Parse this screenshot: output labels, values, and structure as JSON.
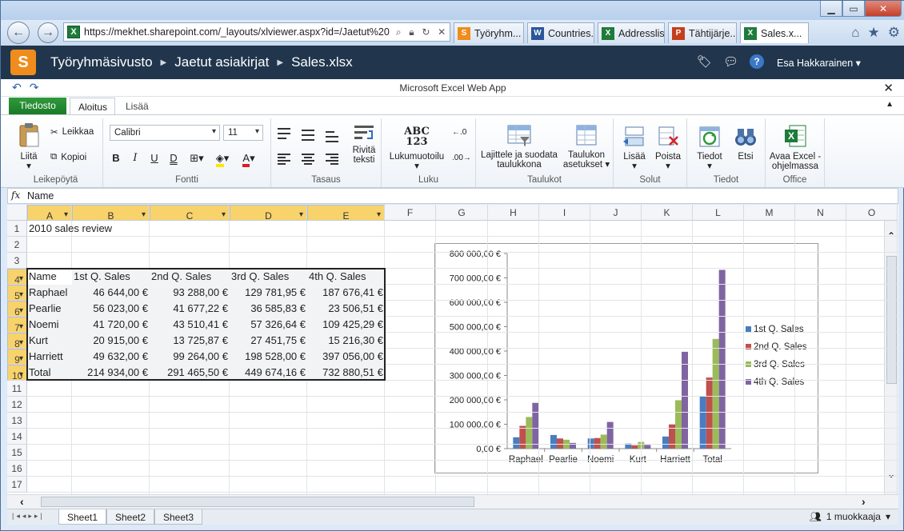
{
  "browser": {
    "url": "https://mekhet.sharepoint.com/_layouts/xlviewer.aspx?id=/Jaetut%20",
    "tabs": [
      {
        "label": "Työryhm...",
        "icon": "sharepoint",
        "color": "#f08c1c"
      },
      {
        "label": "Countries...",
        "icon": "word",
        "color": "#2b579a"
      },
      {
        "label": "Addresslis...",
        "icon": "excel",
        "color": "#1e7b3b"
      },
      {
        "label": "Tähtijärje...",
        "icon": "powerpoint",
        "color": "#c43e1c"
      },
      {
        "label": "Sales.x...",
        "icon": "excel",
        "color": "#1e7b3b"
      }
    ]
  },
  "sharepoint": {
    "breadcrumb": [
      "Työryhmäsivusto",
      "Jaetut asiakirjat",
      "Sales.xlsx"
    ],
    "user": "Esa Hakkarainen",
    "help": "?"
  },
  "app": {
    "title": "Microsoft Excel Web App",
    "tabs": {
      "file": "Tiedosto",
      "home": "Aloitus",
      "more": "Lisää"
    }
  },
  "ribbon": {
    "paste": "Liitä",
    "cut": "Leikkaa",
    "copy": "Kopioi",
    "clipboard_group": "Leikepöytä",
    "font_name": "Calibri",
    "font_size": "11",
    "font_group": "Fontti",
    "bold": "B",
    "italic": "I",
    "underline": "U",
    "double_underline": "D",
    "wrap": "Rivitä teksti",
    "align_group": "Tasaus",
    "number_format": "Lukumuotoilu",
    "number_icon": "ABC 123",
    "number_group": "Luku",
    "sort_filter": "Lajittele ja suodata taulukkona",
    "table_options": "Taulukon asetukset",
    "tables_group": "Taulukot",
    "insert": "Lisää",
    "delete": "Poista",
    "cells_group": "Solut",
    "data": "Tiedot",
    "find": "Etsi",
    "data_group": "Tiedot",
    "open_excel": "Avaa Excel -ohjelmassa",
    "office_group": "Office"
  },
  "formula_bar": {
    "fx": "fx",
    "value": "Name"
  },
  "columns": [
    "A",
    "B",
    "C",
    "D",
    "E",
    "F",
    "G",
    "H",
    "I",
    "J",
    "K",
    "L",
    "M",
    "N",
    "O"
  ],
  "rows": [
    "1",
    "2",
    "3",
    "4",
    "5",
    "6",
    "7",
    "8",
    "9",
    "10",
    "11",
    "12",
    "13",
    "14",
    "15",
    "16",
    "17"
  ],
  "sheet": {
    "a1": "2010 sales review",
    "header": [
      "Name",
      "1st Q. Sales",
      "2nd Q. Sales",
      "3rd Q. Sales",
      "4th Q. Sales"
    ],
    "data": [
      [
        "Raphael",
        "46 644,00 €",
        "93 288,00 €",
        "129 781,95 €",
        "187 676,41 €"
      ],
      [
        "Pearlie",
        "56 023,00 €",
        "41 677,22 €",
        "36 585,83 €",
        "23 506,51 €"
      ],
      [
        "Noemi",
        "41 720,00 €",
        "43 510,41 €",
        "57 326,64 €",
        "109 425,29 €"
      ],
      [
        "Kurt",
        "20 915,00 €",
        "13 725,87 €",
        "27 451,75 €",
        "15 216,30 €"
      ],
      [
        "Harriett",
        "49 632,00 €",
        "99 264,00 €",
        "198 528,00 €",
        "397 056,00 €"
      ],
      [
        "Total",
        "214 934,00 €",
        "291 465,50 €",
        "449 674,16 €",
        "732 880,51 €"
      ]
    ]
  },
  "chart_data": {
    "type": "bar",
    "categories": [
      "Raphael",
      "Pearlie",
      "Noemi",
      "Kurt",
      "Harriett",
      "Total"
    ],
    "series": [
      {
        "name": "1st Q. Sales",
        "color": "#4a7dbf",
        "values": [
          46644,
          56023,
          41720,
          20915,
          49632,
          214934
        ]
      },
      {
        "name": "2nd Q. Sales",
        "color": "#c0504d",
        "values": [
          93288,
          41677.22,
          43510.41,
          13725.87,
          99264,
          291465.5
        ]
      },
      {
        "name": "3rd Q. Sales",
        "color": "#9bbb59",
        "values": [
          129781.95,
          36585.83,
          57326.64,
          27451.75,
          198528,
          449674.16
        ]
      },
      {
        "name": "4th Q. Sales",
        "color": "#8064a2",
        "values": [
          187676.41,
          23506.51,
          109425.29,
          15216.3,
          397056,
          732880.51
        ]
      }
    ],
    "yticks": [
      "0,00 €",
      "100 000,00 €",
      "200 000,00 €",
      "300 000,00 €",
      "400 000,00 €",
      "500 000,00 €",
      "600 000,00 €",
      "700 000,00 €",
      "800 000,00 €"
    ],
    "ylim": [
      0,
      800000
    ],
    "legend_position": "right",
    "grid": false
  },
  "sheet_tabs": [
    "Sheet1",
    "Sheet2",
    "Sheet3"
  ],
  "status": {
    "editors": "1 muokkaaja"
  }
}
